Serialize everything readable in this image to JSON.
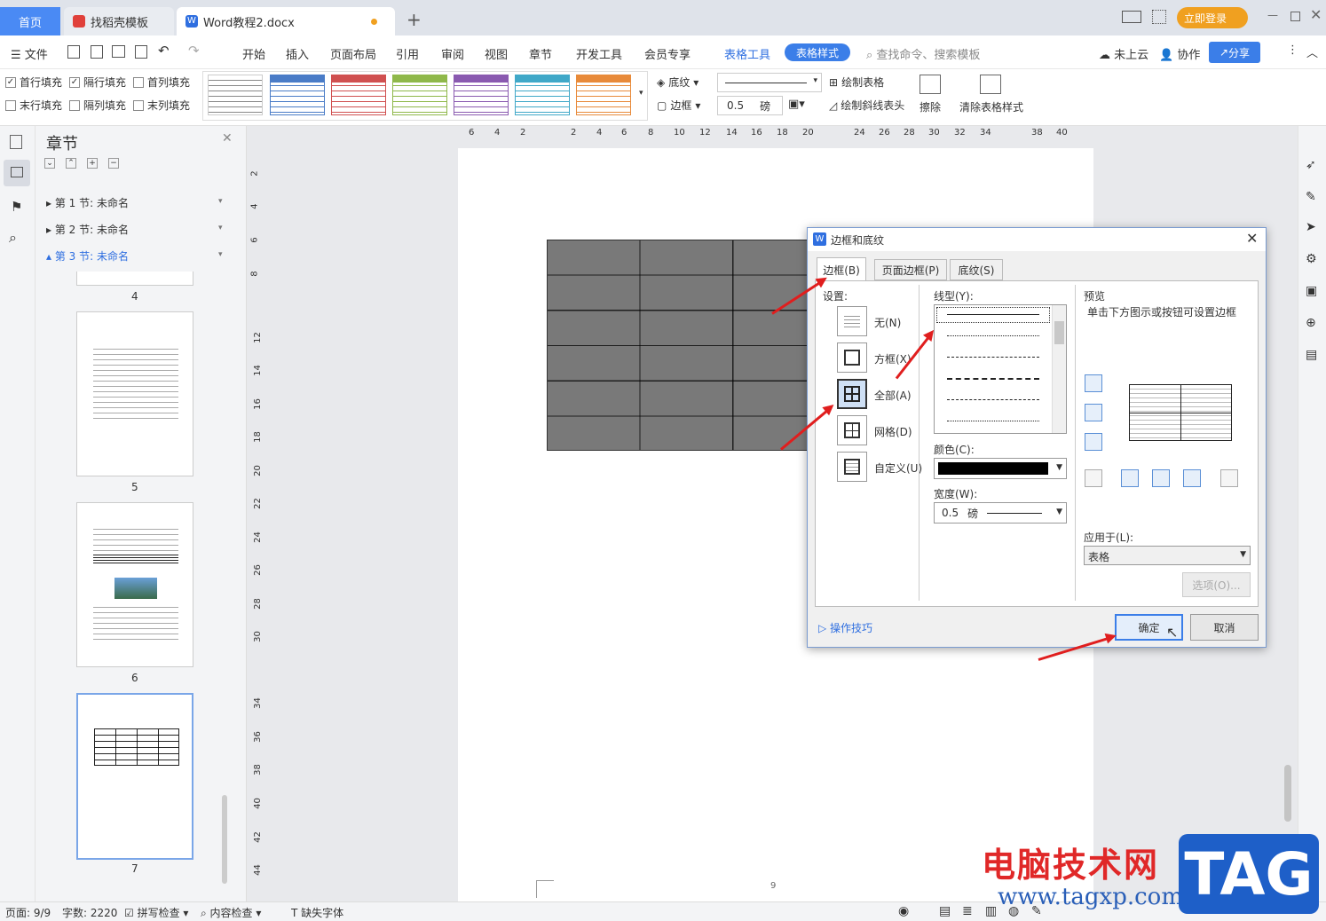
{
  "tabs": {
    "home": "首页",
    "template": "找稻壳模板",
    "doc": "Word教程2.docx"
  },
  "titlebar": {
    "login": "立即登录"
  },
  "menu": {
    "file": "文件",
    "items": [
      "开始",
      "插入",
      "页面布局",
      "引用",
      "审阅",
      "视图",
      "章节",
      "开发工具",
      "会员专享"
    ],
    "table_tools": "表格工具",
    "table_style": "表格样式",
    "search_placeholder": "查找命令、搜索模板",
    "cloud": "未上云",
    "collab": "协作",
    "share": "分享"
  },
  "ribbon": {
    "first_row_fill": "首行填充",
    "alt_row_fill": "隔行填充",
    "first_col_fill": "首列填充",
    "last_row_fill": "末行填充",
    "alt_col_fill": "隔列填充",
    "last_col_fill": "末列填充",
    "shading": "底纹",
    "border": "边框",
    "width_value": "0.5",
    "width_unit": "磅",
    "draw_table": "绘制表格",
    "draw_diag": "绘制斜线表头",
    "eraser": "擦除",
    "clear_style": "清除表格样式",
    "style_colors": [
      "#4a7cc7",
      "#d05050",
      "#8fb84a",
      "#8a5ab0",
      "#40a8c8",
      "#e88a3a"
    ]
  },
  "nav": {
    "title": "章节",
    "sections": [
      "第 1 节: 未命名",
      "第 2 节: 未命名",
      "第 3 节: 未命名"
    ],
    "page_numbers": [
      "4",
      "5",
      "6",
      "7"
    ]
  },
  "ruler": {
    "h_ticks": [
      "6",
      "4",
      "2",
      "2",
      "4",
      "6",
      "8",
      "10",
      "12",
      "14",
      "16",
      "18",
      "20",
      "24",
      "26",
      "28",
      "30",
      "32",
      "34",
      "38",
      "40"
    ],
    "v_ticks": [
      "2",
      "4",
      "6",
      "8",
      "12",
      "14",
      "16",
      "18",
      "20",
      "22",
      "24",
      "26",
      "28",
      "30",
      "34",
      "36",
      "38",
      "40",
      "42",
      "44"
    ]
  },
  "page": {
    "footer_number": "9"
  },
  "dialog": {
    "title": "边框和底纹",
    "tab_border": "边框(B)",
    "tab_page_border": "页面边框(P)",
    "tab_shading": "底纹(S)",
    "settings_label": "设置:",
    "set_none": "无(N)",
    "set_box": "方框(X)",
    "set_all": "全部(A)",
    "set_grid": "网格(D)",
    "set_custom": "自定义(U)",
    "line_style_label": "线型(Y):",
    "color_label": "颜色(C):",
    "width_label": "宽度(W):",
    "width_value": "0.5",
    "width_unit": "磅",
    "preview_label": "预览",
    "preview_hint": "单击下方图示或按钮可设置边框",
    "apply_label": "应用于(L):",
    "apply_value": "表格",
    "options": "选项(O)...",
    "tips": "操作技巧",
    "ok": "确定",
    "cancel": "取消"
  },
  "status": {
    "page": "页面: 9/9",
    "words": "字数: 2220",
    "spell": "拼写检查",
    "content": "内容检查",
    "font": "缺失字体"
  },
  "watermark": {
    "text": "电脑技术网",
    "url": "www.tagxp.com",
    "logo": "TAG"
  }
}
